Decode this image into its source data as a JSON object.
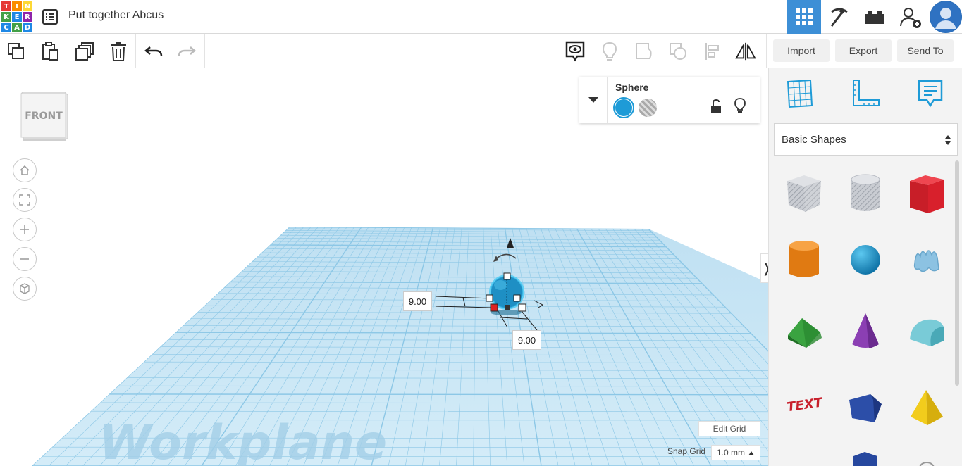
{
  "header": {
    "title": "Put together Abcus",
    "logo_letters": [
      "T",
      "I",
      "N",
      "K",
      "E",
      "R",
      "C",
      "A",
      "D"
    ],
    "logo_colors": [
      "#e53935",
      "#fb8c00",
      "#fdd835",
      "#43a047",
      "#1e88e5",
      "#8e24aa",
      "#1e88e5",
      "#43a047",
      "#1e88e5"
    ],
    "nav_icons": [
      "grid-view-icon",
      "pickaxe-icon",
      "brick-icon",
      "add-user-icon",
      "user-avatar"
    ]
  },
  "toolbar": {
    "import_label": "Import",
    "export_label": "Export",
    "send_to_label": "Send To"
  },
  "viewport": {
    "viewcube_label": "FRONT",
    "workplane_label": "Workplane",
    "dim_height": "9.00",
    "dim_width": "9.00",
    "edit_grid_label": "Edit Grid",
    "snap_grid_label": "Snap Grid",
    "snap_grid_value": "1.0 mm",
    "collapse_glyph": "❭"
  },
  "inspector": {
    "shape_name": "Sphere",
    "solid_color": "#1e9bd7"
  },
  "panel": {
    "category": "Basic Shapes",
    "shapes": [
      {
        "name": "box-hole",
        "color": "#b8bcc4"
      },
      {
        "name": "cylinder-hole",
        "color": "#b8bcc4"
      },
      {
        "name": "box",
        "color": "#d8202c"
      },
      {
        "name": "cylinder",
        "color": "#f08a1c"
      },
      {
        "name": "sphere",
        "color": "#1e9bd7"
      },
      {
        "name": "scribble",
        "color": "#7fb6d9"
      },
      {
        "name": "roof",
        "color": "#3aa340"
      },
      {
        "name": "cone",
        "color": "#8b3fb3"
      },
      {
        "name": "round-roof",
        "color": "#66c2cf"
      },
      {
        "name": "text",
        "color": "#c8202c"
      },
      {
        "name": "wedge",
        "color": "#26479e"
      },
      {
        "name": "pyramid",
        "color": "#f2cc1c"
      }
    ]
  }
}
